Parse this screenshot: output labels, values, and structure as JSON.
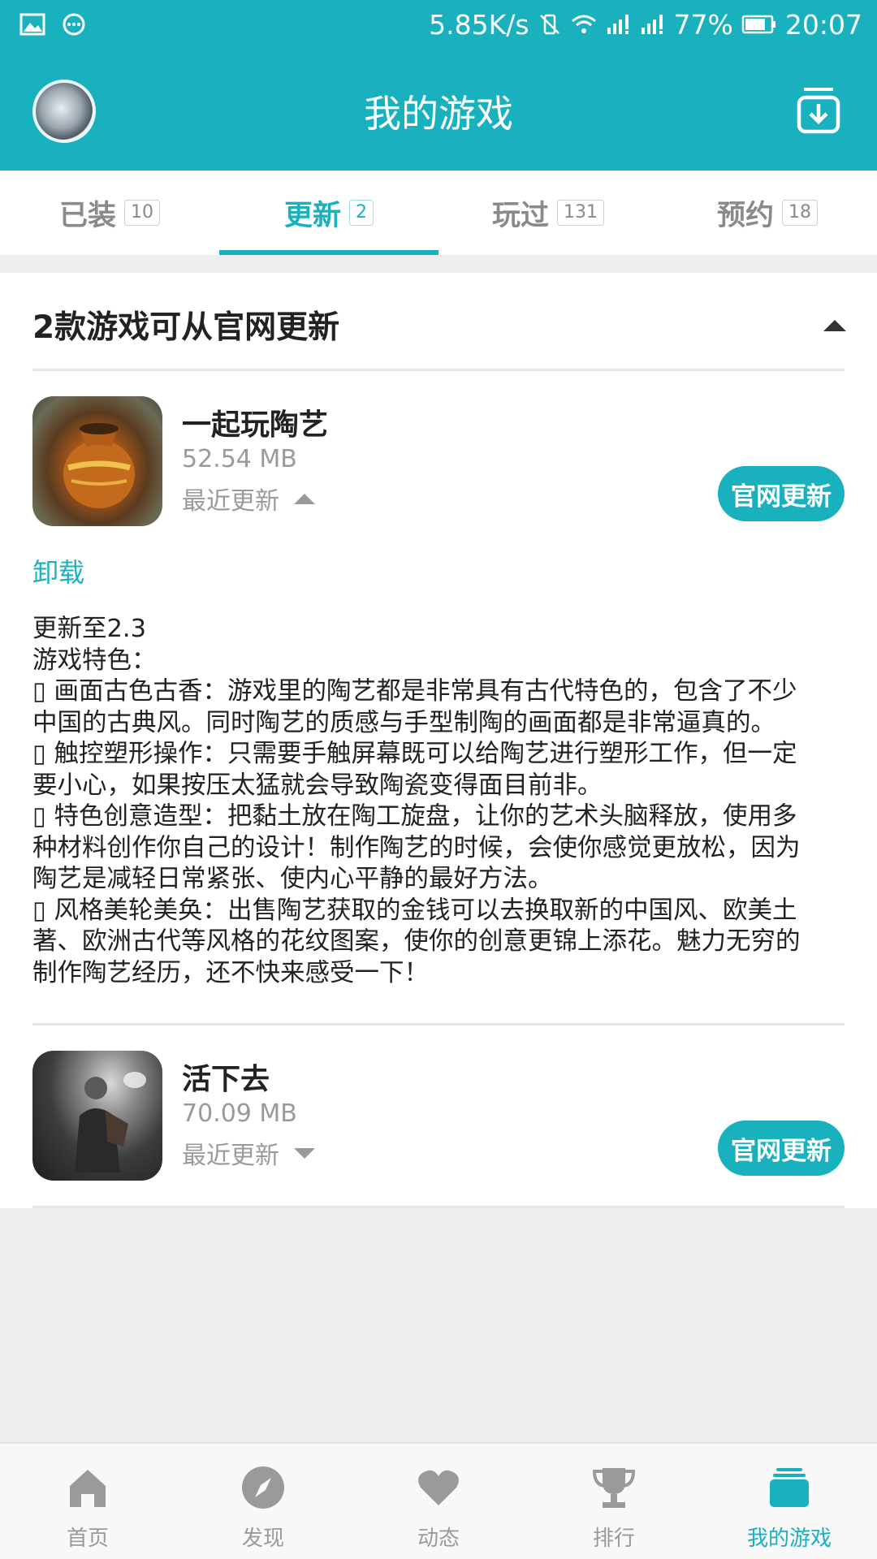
{
  "status_bar": {
    "network_speed": "5.85K/s",
    "battery": "77%",
    "time": "20:07"
  },
  "header": {
    "title": "我的游戏"
  },
  "tabs": [
    {
      "label": "已装",
      "count": "10"
    },
    {
      "label": "更新",
      "count": "2",
      "active": true
    },
    {
      "label": "玩过",
      "count": "131"
    },
    {
      "label": "预约",
      "count": "18"
    }
  ],
  "section": {
    "title": "2款游戏可从官网更新"
  },
  "games": [
    {
      "name": "一起玩陶艺",
      "size": "52.54 MB",
      "recent_label": "最近更新",
      "button": "官网更新",
      "expanded": true,
      "uninstall_label": "卸载",
      "description": [
        "更新至2.3",
        "游戏特色：",
        "▯ 画面古色古香：游戏里的陶艺都是非常具有古代特色的，包含了不少",
        "中国的古典风。同时陶艺的质感与手型制陶的画面都是非常逼真的。",
        "▯ 触控塑形操作：只需要手触屏幕既可以给陶艺进行塑形工作，但一定",
        "要小心，如果按压太猛就会导致陶瓷变得面目前非。",
        "▯ 特色创意造型：把黏土放在陶工旋盘，让你的艺术头脑释放，使用多",
        "种材料创作你自己的设计！制作陶艺的时候，会使你感觉更放松，因为",
        "陶艺是减轻日常紧张、使内心平静的最好方法。",
        "▯ 风格美轮美奂：出售陶艺获取的金钱可以去换取新的中国风、欧美土",
        "著、欧洲古代等风格的花纹图案，使你的创意更锦上添花。魅力无穷的",
        "制作陶艺经历，还不快来感受一下！"
      ]
    },
    {
      "name": "活下去",
      "size": "70.09 MB",
      "recent_label": "最近更新",
      "button": "官网更新",
      "expanded": false
    }
  ],
  "bottom_nav": [
    {
      "label": "首页",
      "icon": "home-icon"
    },
    {
      "label": "发现",
      "icon": "compass-icon"
    },
    {
      "label": "动态",
      "icon": "heart-icon"
    },
    {
      "label": "排行",
      "icon": "trophy-icon"
    },
    {
      "label": "我的游戏",
      "icon": "stack-icon",
      "active": true
    }
  ],
  "colors": {
    "accent": "#1ab1bf",
    "inactive": "#9a9a9a",
    "background": "#eeeeee"
  }
}
